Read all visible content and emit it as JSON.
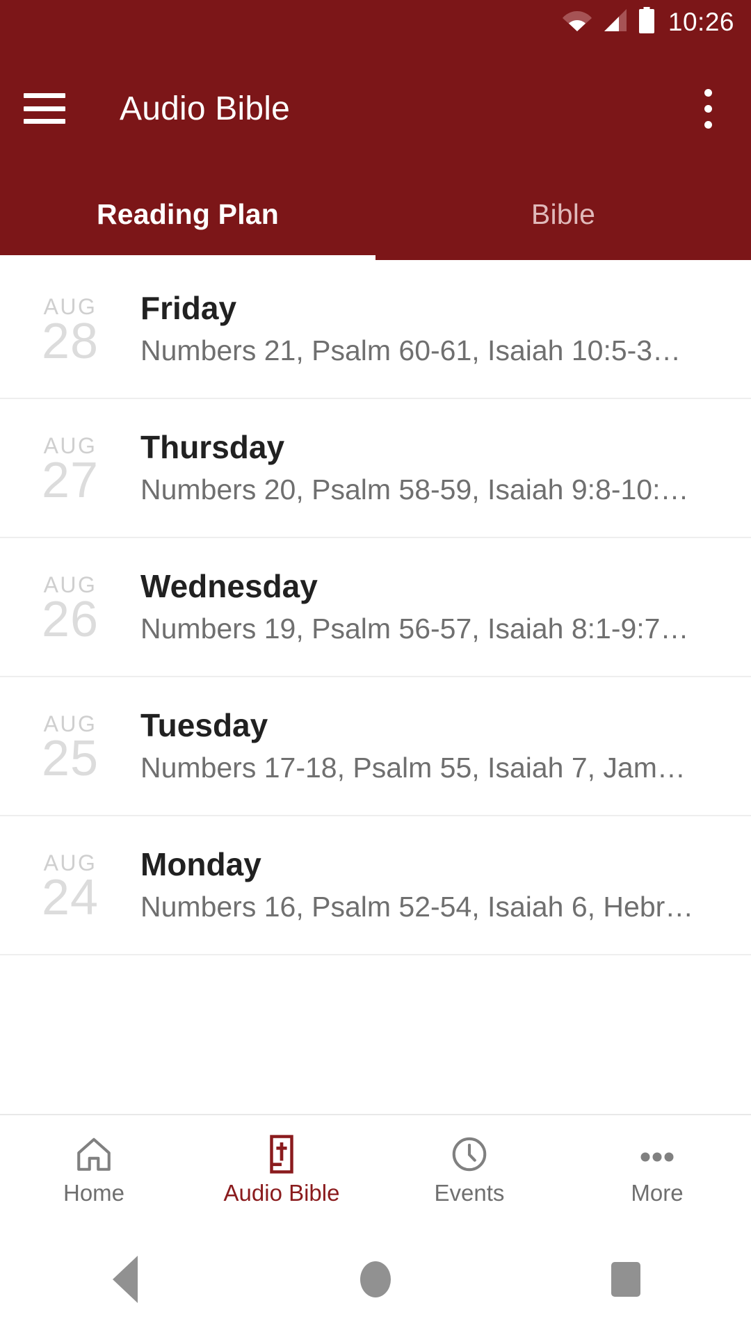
{
  "theme": {
    "brand_red": "#7c1618",
    "accent_red": "#8a1b1d",
    "inactive_grey": "#6f6f6f"
  },
  "status_bar": {
    "time": "10:26",
    "icons": [
      "wifi-icon",
      "cellular-signal-icon",
      "battery-icon"
    ]
  },
  "app_bar": {
    "menu_icon": "hamburger-menu-icon",
    "title": "Audio Bible",
    "overflow_icon": "more-vertical-icon"
  },
  "tabs": [
    {
      "label": "Reading Plan",
      "active": true
    },
    {
      "label": "Bible",
      "active": false
    }
  ],
  "reading_plan": {
    "entries": [
      {
        "month": "AUG",
        "day": "28",
        "weekday": "Friday",
        "passages": "Numbers 21, Psalm 60-61, Isaiah 10:5-3…"
      },
      {
        "month": "AUG",
        "day": "27",
        "weekday": "Thursday",
        "passages": "Numbers 20, Psalm 58-59, Isaiah 9:8-10:…"
      },
      {
        "month": "AUG",
        "day": "26",
        "weekday": "Wednesday",
        "passages": "Numbers 19, Psalm 56-57, Isaiah 8:1-9:7…"
      },
      {
        "month": "AUG",
        "day": "25",
        "weekday": "Tuesday",
        "passages": "Numbers 17-18, Psalm 55, Isaiah 7, Jam…"
      },
      {
        "month": "AUG",
        "day": "24",
        "weekday": "Monday",
        "passages": "Numbers 16, Psalm 52-54, Isaiah 6, Hebr…"
      }
    ]
  },
  "bottom_nav": [
    {
      "label": "Home",
      "icon": "home-icon",
      "active": false
    },
    {
      "label": "Audio Bible",
      "icon": "bible-book-icon",
      "active": true
    },
    {
      "label": "Events",
      "icon": "clock-icon",
      "active": false
    },
    {
      "label": "More",
      "icon": "ellipsis-icon",
      "active": false
    }
  ],
  "system_nav": [
    {
      "icon": "back-triangle-icon"
    },
    {
      "icon": "home-circle-icon"
    },
    {
      "icon": "recents-square-icon"
    }
  ]
}
